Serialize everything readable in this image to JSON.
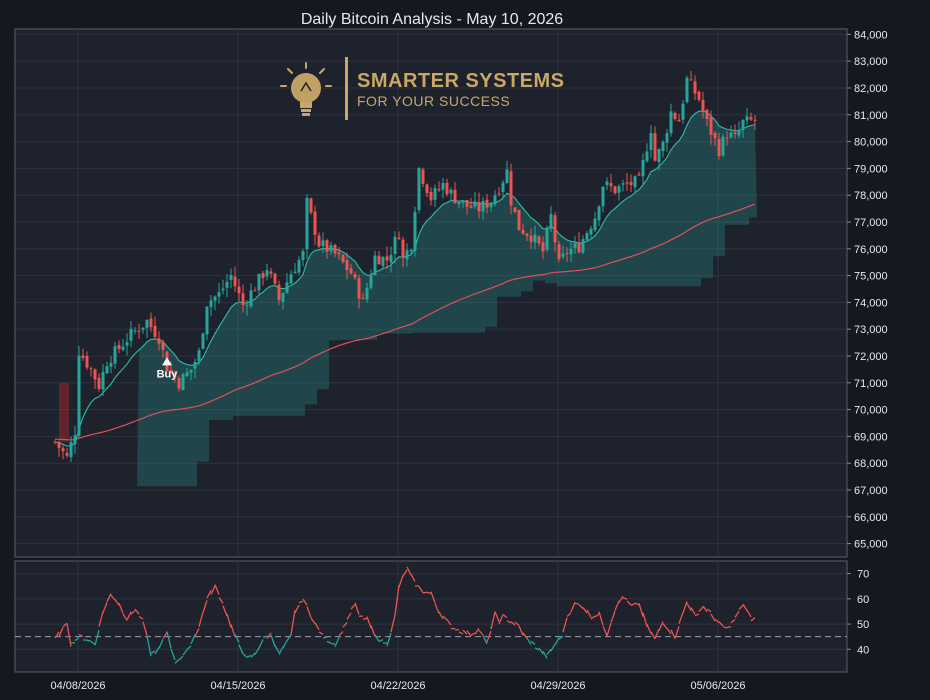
{
  "chart_data": {
    "title": "Daily Bitcoin Analysis - May 10, 2026",
    "type": "candlestick",
    "price_axis": {
      "ylim": [
        64500,
        84200
      ],
      "ticks": [
        "65,000",
        "66,000",
        "67,000",
        "68,000",
        "69,000",
        "70,000",
        "71,000",
        "72,000",
        "73,000",
        "74,000",
        "75,000",
        "76,000",
        "77,000",
        "78,000",
        "79,000",
        "80,000",
        "81,000",
        "82,000",
        "83,000",
        "84,000"
      ]
    },
    "indicator_axis": {
      "ylim": [
        31,
        75
      ],
      "ticks": [
        "40",
        "50",
        "60",
        "70"
      ],
      "reference_line": 45
    },
    "x_axis": {
      "xlim": [
        0,
        150
      ],
      "ticks": [
        {
          "label": "04/08/2026",
          "x": 10
        },
        {
          "label": "04/15/2026",
          "x": 52
        },
        {
          "label": "04/22/2026",
          "x": 94
        },
        {
          "label": "04/29/2026",
          "x": 136
        },
        {
          "label": "05/06/2026",
          "x": 178
        }
      ]
    },
    "candle_anchors": [
      [
        0,
        68800
      ],
      [
        3,
        68200
      ],
      [
        5,
        69200
      ],
      [
        6,
        72200
      ],
      [
        9,
        71500
      ],
      [
        11,
        70900
      ],
      [
        13,
        71800
      ],
      [
        16,
        72300
      ],
      [
        19,
        72800
      ],
      [
        23,
        73300
      ],
      [
        26,
        72700
      ],
      [
        28,
        71600
      ],
      [
        31,
        71000
      ],
      [
        34,
        71500
      ],
      [
        36,
        72100
      ],
      [
        38,
        74000
      ],
      [
        41,
        74300
      ],
      [
        44,
        75000
      ],
      [
        47,
        73900
      ],
      [
        50,
        74600
      ],
      [
        53,
        75300
      ],
      [
        56,
        74100
      ],
      [
        59,
        75100
      ],
      [
        62,
        75800
      ],
      [
        63,
        77700
      ],
      [
        66,
        76200
      ],
      [
        70,
        75800
      ],
      [
        74,
        75100
      ],
      [
        77,
        74000
      ],
      [
        80,
        75700
      ],
      [
        83,
        75600
      ],
      [
        86,
        76600
      ],
      [
        87,
        75600
      ],
      [
        89,
        76200
      ],
      [
        91,
        79000
      ],
      [
        94,
        77900
      ],
      [
        97,
        78400
      ],
      [
        100,
        77900
      ],
      [
        103,
        77600
      ],
      [
        106,
        77500
      ],
      [
        109,
        77800
      ],
      [
        111,
        78300
      ],
      [
        113,
        78900
      ],
      [
        114,
        77800
      ],
      [
        116,
        76800
      ],
      [
        119,
        76500
      ],
      [
        122,
        75900
      ],
      [
        124,
        77200
      ],
      [
        126,
        75400
      ],
      [
        128,
        75900
      ],
      [
        131,
        76100
      ],
      [
        135,
        77200
      ],
      [
        137,
        78400
      ],
      [
        140,
        78200
      ],
      [
        143,
        78400
      ],
      [
        146,
        78500
      ],
      [
        149,
        80500
      ],
      [
        150,
        79300
      ],
      [
        152,
        79900
      ],
      [
        154,
        81100
      ],
      [
        156,
        80800
      ],
      [
        158,
        82300
      ],
      [
        161,
        81600
      ],
      [
        163,
        80700
      ],
      [
        166,
        79700
      ],
      [
        168,
        80300
      ],
      [
        170,
        80100
      ],
      [
        172,
        80700
      ],
      [
        175,
        80800
      ]
    ],
    "indicator_anchors": [
      [
        0,
        44
      ],
      [
        2,
        48
      ],
      [
        3,
        51
      ],
      [
        4,
        42
      ],
      [
        6,
        45
      ],
      [
        8,
        44
      ],
      [
        10,
        42
      ],
      [
        12,
        55
      ],
      [
        14,
        62
      ],
      [
        16,
        58
      ],
      [
        18,
        52
      ],
      [
        20,
        56
      ],
      [
        22,
        51
      ],
      [
        24,
        38
      ],
      [
        26,
        40
      ],
      [
        28,
        47
      ],
      [
        30,
        35
      ],
      [
        33,
        39
      ],
      [
        36,
        49
      ],
      [
        38,
        60
      ],
      [
        40,
        65
      ],
      [
        42,
        58
      ],
      [
        45,
        45
      ],
      [
        48,
        36
      ],
      [
        50,
        38
      ],
      [
        52,
        44
      ],
      [
        54,
        46
      ],
      [
        56,
        38
      ],
      [
        59,
        45
      ],
      [
        60,
        55
      ],
      [
        62,
        60
      ],
      [
        65,
        50
      ],
      [
        67,
        45
      ],
      [
        70,
        42
      ],
      [
        72,
        48
      ],
      [
        74,
        55
      ],
      [
        75,
        58
      ],
      [
        76,
        53
      ],
      [
        78,
        52
      ],
      [
        80,
        45
      ],
      [
        82,
        43
      ],
      [
        83,
        42
      ],
      [
        85,
        53
      ],
      [
        86,
        65
      ],
      [
        88,
        72
      ],
      [
        90,
        66
      ],
      [
        92,
        63
      ],
      [
        94,
        62
      ],
      [
        96,
        55
      ],
      [
        99,
        49
      ],
      [
        102,
        47
      ],
      [
        104,
        46
      ],
      [
        106,
        48
      ],
      [
        108,
        42
      ],
      [
        110,
        54
      ],
      [
        111,
        51
      ],
      [
        112,
        53
      ],
      [
        114,
        51
      ],
      [
        116,
        49
      ],
      [
        117,
        46
      ],
      [
        118,
        44
      ],
      [
        121,
        40
      ],
      [
        123,
        37
      ],
      [
        125,
        42
      ],
      [
        127,
        46
      ],
      [
        128,
        53
      ],
      [
        130,
        58
      ],
      [
        132,
        57
      ],
      [
        134,
        53
      ],
      [
        136,
        54
      ],
      [
        138,
        46
      ],
      [
        140,
        56
      ],
      [
        142,
        61
      ],
      [
        144,
        57
      ],
      [
        146,
        58
      ],
      [
        148,
        49
      ],
      [
        150,
        44
      ],
      [
        152,
        51
      ],
      [
        155,
        45
      ],
      [
        158,
        59
      ],
      [
        160,
        53
      ],
      [
        162,
        57
      ],
      [
        164,
        54
      ],
      [
        166,
        50
      ],
      [
        168,
        48
      ],
      [
        170,
        52
      ],
      [
        172,
        58
      ],
      [
        174,
        52
      ]
    ],
    "annotations": [
      {
        "text": "Buy",
        "x": 28
      }
    ]
  },
  "logo": {
    "brand": "SMARTER SYSTEMS",
    "tagline": "FOR YOUR SUCCESS",
    "icon": "lightbulb-icon"
  },
  "colors": {
    "background": "#141821",
    "plot_background": "#1e222d",
    "grid": "#2e3340",
    "up_candle": "#26a69a",
    "down_candle": "#ef5350",
    "ema_fast": "#2bbfa6",
    "ema_slow": "#e0505a",
    "cloud_fill": "rgba(38,166,154,0.28)",
    "indicator_up": "#26a69a",
    "indicator_down": "#ef5350",
    "logo": "#c9a866"
  }
}
